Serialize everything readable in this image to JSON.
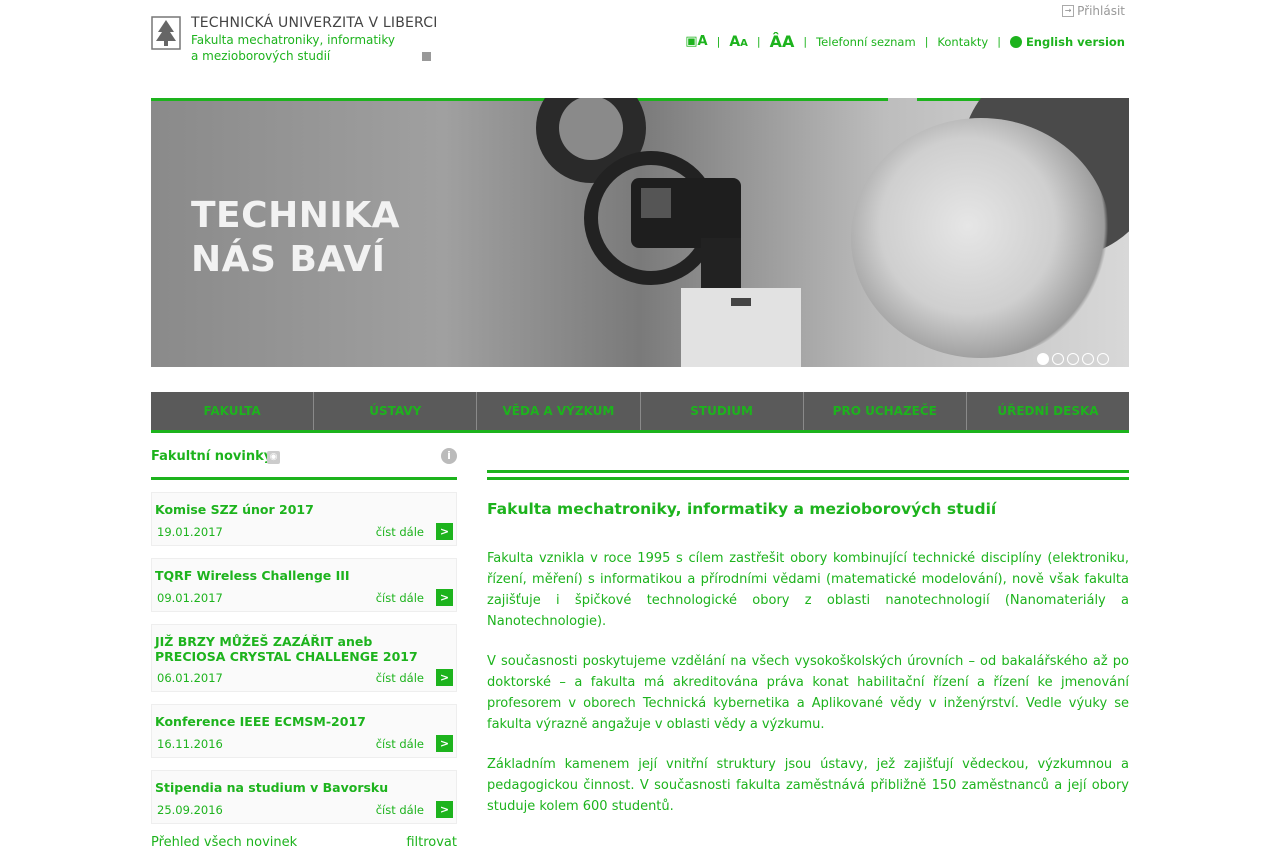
{
  "header": {
    "university": "TECHNICKÁ UNIVERZITA V LIBERCI",
    "faculty_line1": "Fakulta mechatroniky, informatiky",
    "faculty_line2": "a mezioborových studií",
    "login": "Přihlásit",
    "font_small": "A",
    "font_normal": "A",
    "font_large": "A",
    "phonebook": "Telefonní seznam",
    "contacts": "Kontakty",
    "english": "English version"
  },
  "banner": {
    "slogan_line1": "TECHNIKA",
    "slogan_line2": "NÁS BAVÍ",
    "slide_count": 5,
    "active_slide": 1
  },
  "nav": {
    "items": [
      "FAKULTA",
      "ÚSTAVY",
      "VĚDA A VÝZKUM",
      "STUDIUM",
      "PRO UCHAZEČE",
      "ÚŘEDNÍ DESKA"
    ]
  },
  "news": {
    "title": "Fakultní novinky",
    "more_label": "číst dále",
    "items": [
      {
        "title": "Komise SZZ únor 2017",
        "date": "19.01.2017"
      },
      {
        "title": "TQRF Wireless Challenge III",
        "date": "09.01.2017"
      },
      {
        "title": "JIŽ BRZY MŮŽEŠ ZAZÁŘIT aneb PRECIOSA CRYSTAL CHALLENGE 2017",
        "date": "06.01.2017"
      },
      {
        "title": "Konference IEEE ECMSM-2017",
        "date": "16.11.2016"
      },
      {
        "title": "Stipendia na studium v Bavorsku",
        "date": "25.09.2016"
      }
    ],
    "all_news": "Přehled všech novinek",
    "filter": "filtrovat"
  },
  "main": {
    "heading": "Fakulta mechatroniky, informatiky a mezioborových studií",
    "paragraphs": [
      "Fakulta vznikla v roce 1995 s cílem zastřešit obory kombinující technické disciplíny (elektroniku, řízení, měření) s informatikou a přírodními vědami (matematické modelování), nově však fakulta zajišťuje i špičkové technologické obory z oblasti nanotechnologií (Nanomateriály a Nanotechnologie).",
      "V současnosti poskytujeme vzdělání na všech vysokoškolských úrovních – od bakalářského až po doktorské – a fakulta má akreditována práva konat habilitační řízení a řízení ke jmenování profesorem v oborech Technická kybernetika a Aplikované vědy v inženýrství. Vedle výuky se fakulta výrazně angažuje v oblasti vědy a výzkumu.",
      "Základním kamenem její vnitřní struktury jsou ústavy, jež zajišťují vědeckou, výzkumnou a pedagogickou činnost. V současnosti fakulta zaměstnává přibližně 150 zaměstnanců a její obory studuje kolem 600 studentů."
    ]
  },
  "colors": {
    "accent": "#1db31d",
    "nav_bg": "#5a5a5a"
  }
}
